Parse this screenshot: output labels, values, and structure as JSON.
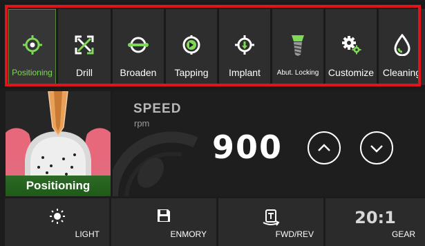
{
  "modes": [
    {
      "label": "Positioning",
      "icon": "crosshair-icon",
      "active": true
    },
    {
      "label": "Drill",
      "icon": "expand-arrows-icon"
    },
    {
      "label": "Broaden",
      "icon": "broaden-icon"
    },
    {
      "label": "Tapping",
      "icon": "tapping-icon"
    },
    {
      "label": "Implant",
      "icon": "implant-icon"
    },
    {
      "label": "Abut. Locking",
      "icon": "abutment-screw-icon"
    },
    {
      "label": "Customize",
      "icon": "gears-icon"
    },
    {
      "label": "Cleaning",
      "icon": "water-drop-icon"
    }
  ],
  "illustration": {
    "caption": "Positioning"
  },
  "speed": {
    "title": "SPEED",
    "unit": "rpm",
    "value": "900"
  },
  "bottom": {
    "light": "LIGHT",
    "memory": "ENMORY",
    "direction": "FWD/REV",
    "gear_value": "20:1",
    "gear": "GEAR"
  },
  "colors": {
    "accent": "#7ed957",
    "highlight": "#e2141b"
  }
}
